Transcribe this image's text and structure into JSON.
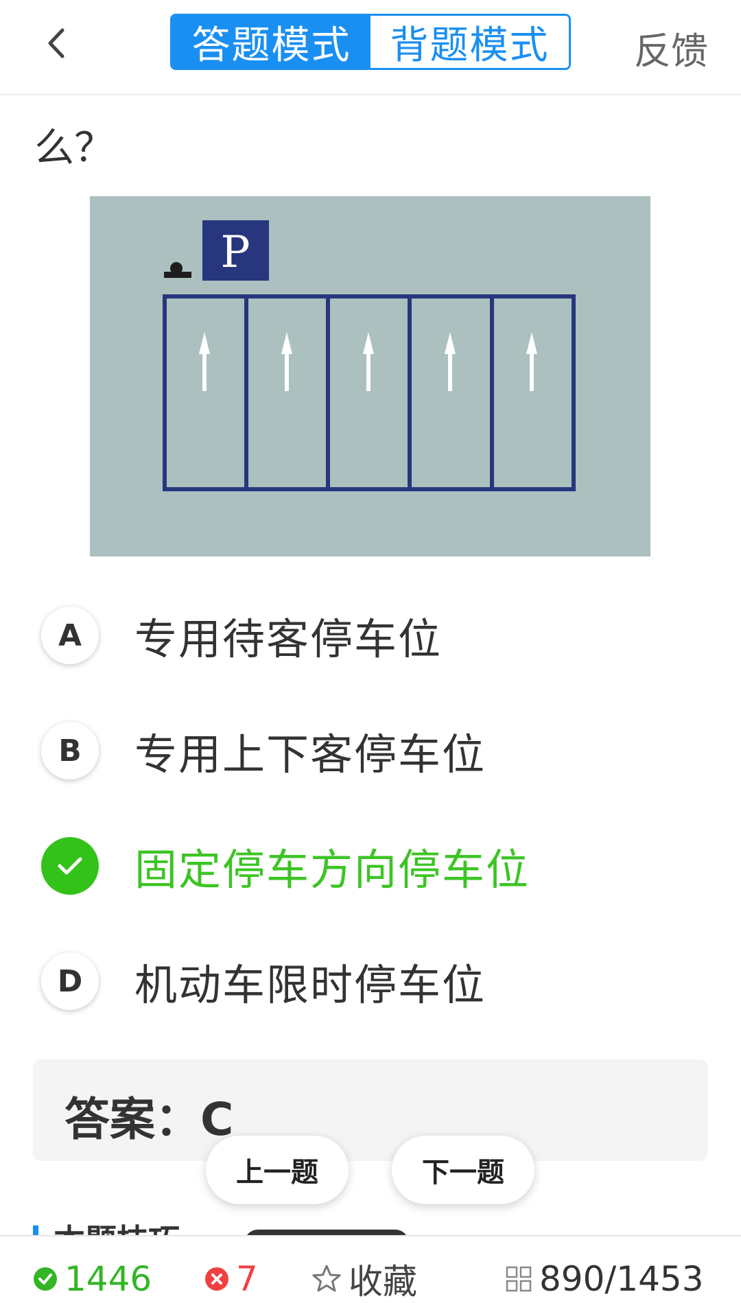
{
  "header": {
    "back_icon": "chevron-left-icon",
    "mode_tabs": [
      {
        "label": "答题模式",
        "active": true
      },
      {
        "label": "背题模式",
        "active": false
      }
    ],
    "feedback_label": "反馈"
  },
  "question": {
    "text_fragment": "么？",
    "image": {
      "sign_letter": "P",
      "stall_count": 5,
      "arrow_icon": "arrow-up-icon"
    }
  },
  "options": [
    {
      "letter": "A",
      "text": "专用待客停车位",
      "state": "normal"
    },
    {
      "letter": "B",
      "text": "专用上下客停车位",
      "state": "normal"
    },
    {
      "letter": "C",
      "text": "固定停车方向停车位",
      "state": "correct",
      "icon": "check-icon"
    },
    {
      "letter": "D",
      "text": "机动车限时停车位",
      "state": "normal"
    }
  ],
  "answer": {
    "text": "答案：C"
  },
  "navigation": {
    "prev_label": "上一题",
    "next_label": "下一题"
  },
  "peek_section": {
    "title": "本题技巧"
  },
  "bottom_bar": {
    "correct_count": "1446",
    "wrong_count": "7",
    "favorite_label": "收藏",
    "progress": "890/1453"
  },
  "colors": {
    "accent": "#1a8ff2",
    "correct": "#33c21a",
    "wrong": "#f04141",
    "image_bg": "#abc0bf",
    "stall_line": "#27367d"
  }
}
